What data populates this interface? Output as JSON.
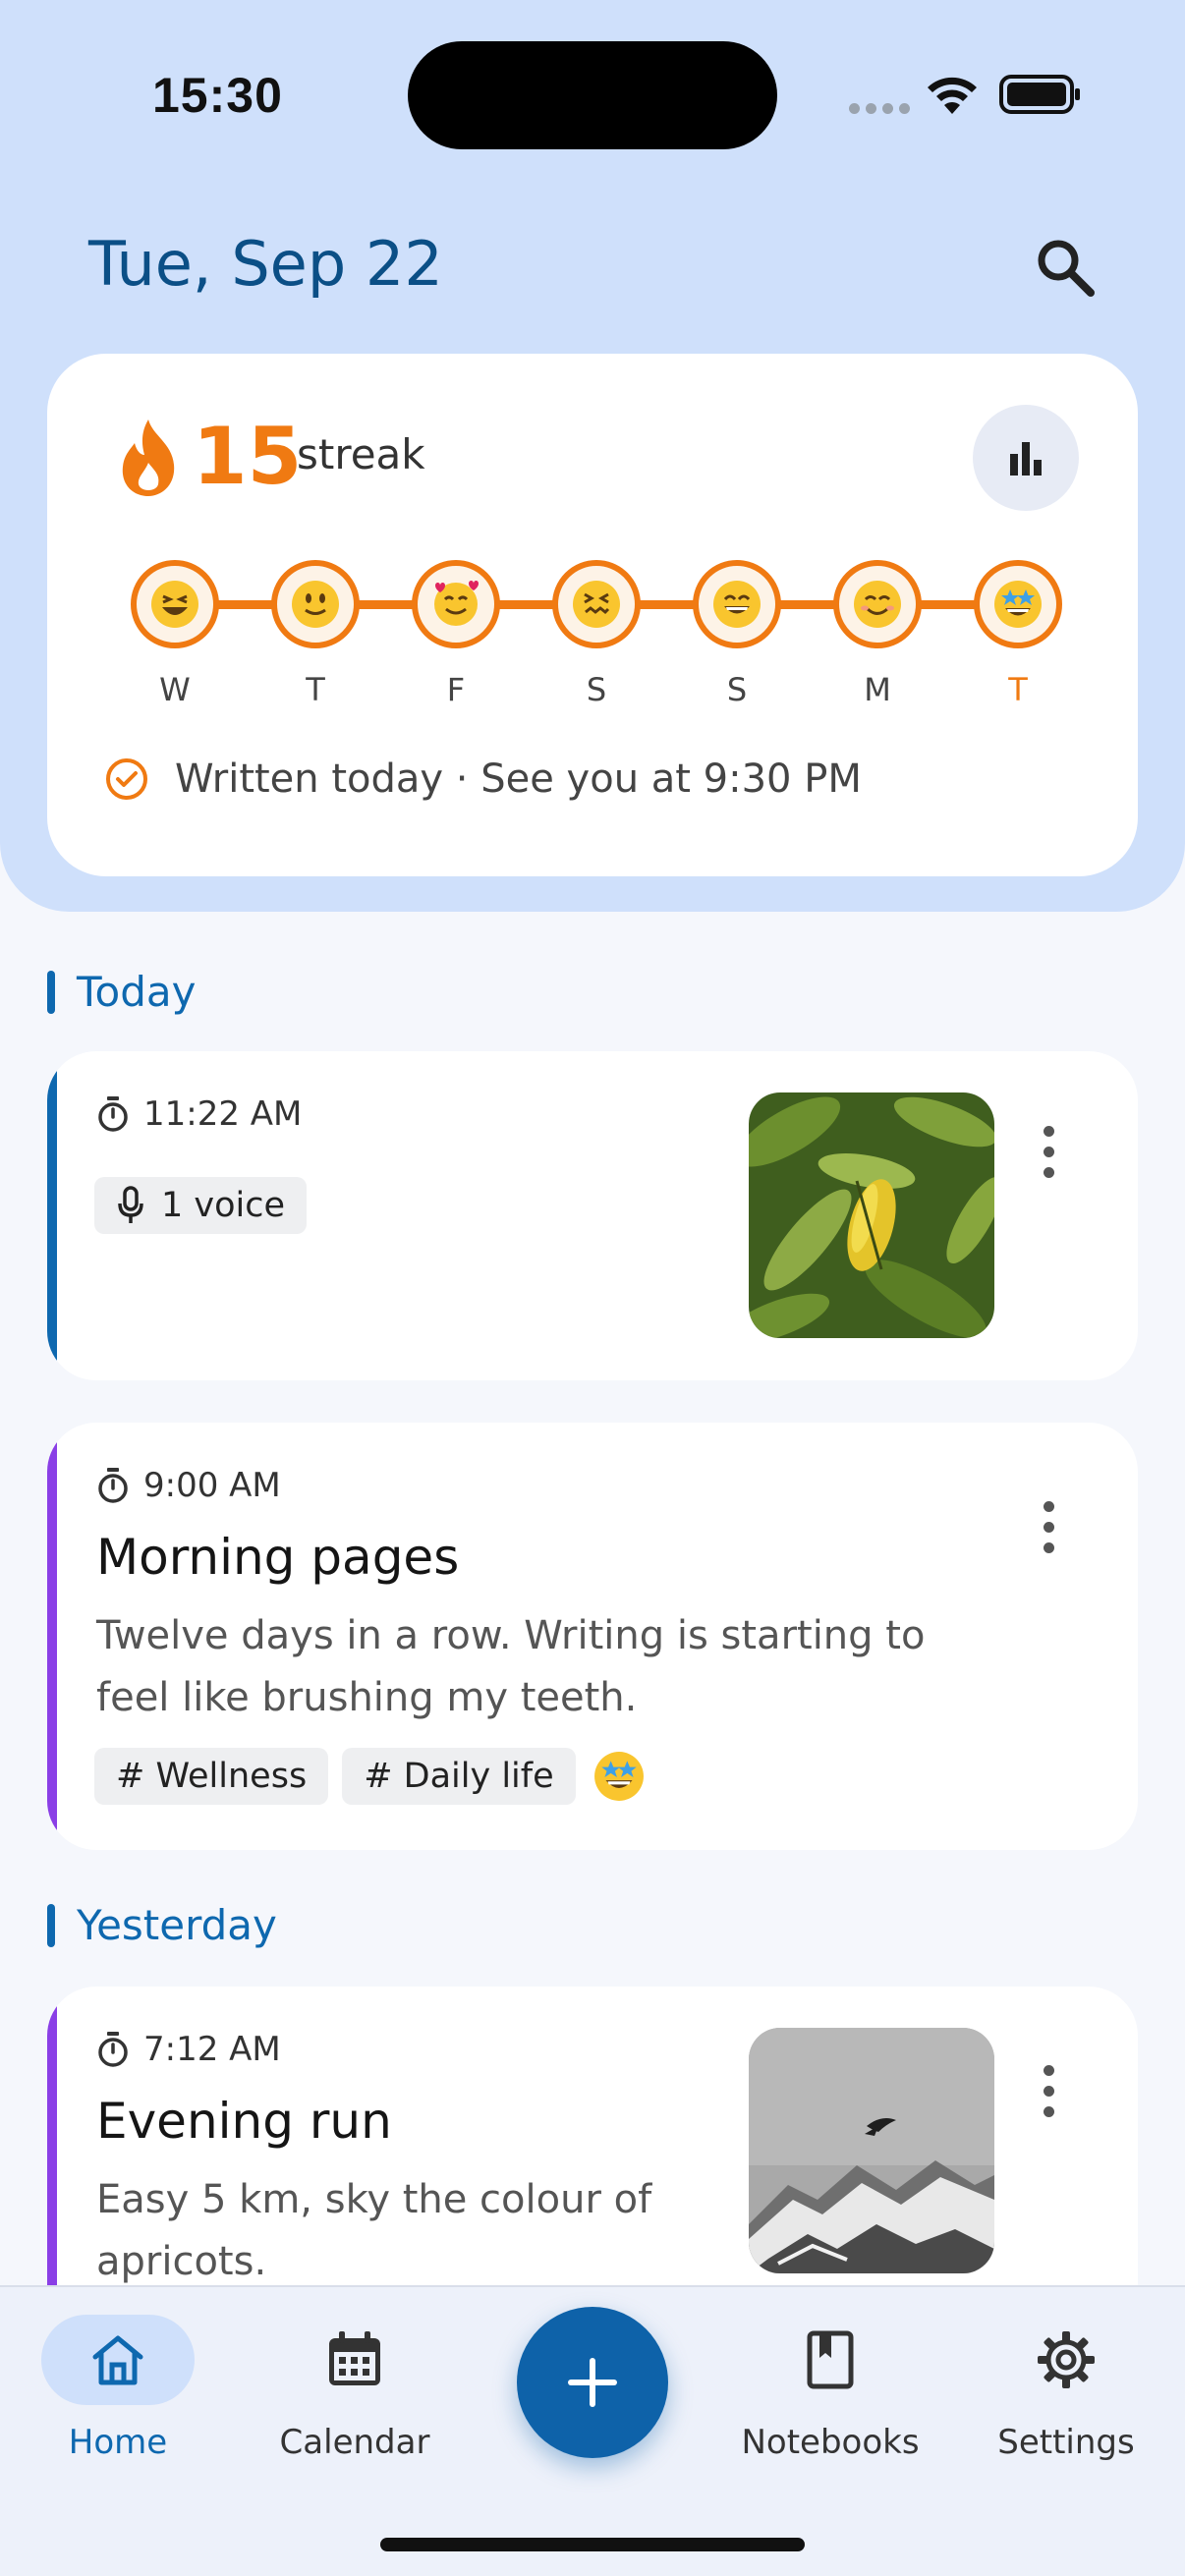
{
  "status_bar": {
    "time": "15:30"
  },
  "header": {
    "date": "Tue, Sep 22"
  },
  "streak": {
    "count": "15",
    "label": "streak",
    "days": [
      {
        "letter": "W",
        "mood": "grinning-squint"
      },
      {
        "letter": "T",
        "mood": "slight-smile"
      },
      {
        "letter": "F",
        "mood": "smiling-hearts"
      },
      {
        "letter": "S",
        "mood": "confounded"
      },
      {
        "letter": "S",
        "mood": "grinning"
      },
      {
        "letter": "M",
        "mood": "smiling"
      },
      {
        "letter": "T",
        "mood": "star-struck"
      }
    ],
    "written_status": "Written today · See you at 9:30 PM"
  },
  "sections": {
    "today": "Today",
    "yesterday": "Yesterday"
  },
  "entries": [
    {
      "time": "11:22 AM",
      "voice_chip": "1 voice",
      "accent": "#0E68AF",
      "thumb": "leaves-photo"
    },
    {
      "time": "9:00 AM",
      "title": "Morning pages",
      "body": "Twelve days in a row. Writing is starting to feel like brushing my teeth.",
      "tags": [
        "# Wellness",
        "# Daily life"
      ],
      "accent": "#8A3FE6"
    },
    {
      "time": "7:12 AM",
      "title": "Evening run",
      "body": "Easy 5 km, sky the colour of apricots.",
      "accent": "#8A3FE6",
      "thumb": "mountain-bird-photo"
    }
  ],
  "nav": {
    "home": "Home",
    "calendar": "Calendar",
    "notebooks": "Notebooks",
    "settings": "Settings"
  },
  "colors": {
    "primary": "#0E68AF",
    "streak_orange": "#F07A12",
    "hero_bg": "#CFE0FB"
  }
}
